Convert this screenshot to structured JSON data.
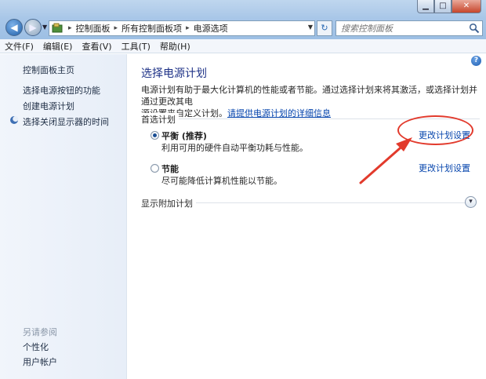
{
  "window": {
    "min_icon": "minimize-icon",
    "max_icon": "maximize-icon",
    "close_icon": "close-icon"
  },
  "address": {
    "crumbs": [
      "控制面板",
      "所有控制面板项",
      "电源选项"
    ],
    "search_placeholder": "搜索控制面板"
  },
  "menu": {
    "items": [
      "文件(F)",
      "编辑(E)",
      "查看(V)",
      "工具(T)",
      "帮助(H)"
    ]
  },
  "sidebar": {
    "home": "控制面板主页",
    "links": [
      "选择电源按钮的功能",
      "创建电源计划",
      "选择关闭显示器的时间"
    ],
    "see_also": "另请参阅",
    "see_also_links": [
      "个性化",
      "用户帐户"
    ]
  },
  "main": {
    "title": "选择电源计划",
    "desc_line1": "电源计划有助于最大化计算机的性能或者节能。通过选择计划来将其激活，或选择计划并通过更改其电",
    "desc_line2_prefix": "源设置来自定义计划。",
    "desc_link": "请提供电源计划的详细信息",
    "preferred_label": "首选计划",
    "plans": [
      {
        "name": "平衡 (推荐)",
        "desc": "利用可用的硬件自动平衡功耗与性能。",
        "link": "更改计划设置",
        "selected": true
      },
      {
        "name": "节能",
        "desc": "尽可能降低计算机性能以节能。",
        "link": "更改计划设置",
        "selected": false
      }
    ],
    "additional_label": "显示附加计划"
  },
  "annotation_color": "#e23a2c"
}
